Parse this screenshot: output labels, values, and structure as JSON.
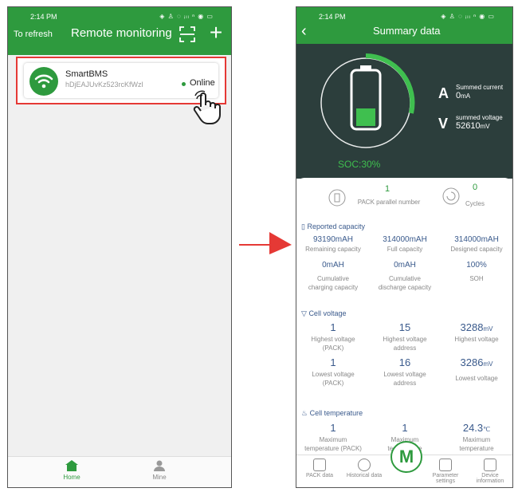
{
  "left_screen": {
    "status": {
      "time": "2:14 PM",
      "icons": "◈ ♙ ◌ ᵢₗₗ ⁿ ◉ ▭"
    },
    "header": {
      "refresh": "To refresh",
      "title": "Remote monitoring"
    },
    "device": {
      "name": "SmartBMS",
      "id": "hDjEAJUvKz523rcKfWzl",
      "status": "Online"
    },
    "tabs": [
      {
        "label": "Home"
      },
      {
        "label": "Mine"
      }
    ]
  },
  "right_screen": {
    "status": {
      "time": "2:14 PM",
      "icons": "◈ ♙ ◌ ᵢₗₗ ⁿ ◉ ▭"
    },
    "header": {
      "title": "Summary data"
    },
    "soc": {
      "text": "SOC:30%",
      "value": 0.3
    },
    "summed_current": {
      "label": "Summed current",
      "value": "0",
      "unit": "mA"
    },
    "summed_voltage": {
      "label": "summed voltage",
      "value": "52610",
      "unit": "mV"
    },
    "pack": {
      "value": "1",
      "label": "PACK parallel number"
    },
    "cycles": {
      "value": "0",
      "label": "Cycles"
    },
    "reported_capacity": {
      "title": "Reported capacity",
      "items": [
        {
          "value": "93190mAH",
          "label": "Remaining capacity"
        },
        {
          "value": "314000mAH",
          "label": "Full capacity"
        },
        {
          "value": "314000mAH",
          "label": "Designed capacity"
        },
        {
          "value": "0mAH",
          "label1": "Cumulative",
          "label2": "charging capacity"
        },
        {
          "value": "0mAH",
          "label1": "Cumulative",
          "label2": "discharge capacity"
        },
        {
          "value": "100%",
          "label": "SOH"
        }
      ]
    },
    "cell_voltage": {
      "title": "Cell voltage",
      "highest_pack": {
        "value": "1",
        "label1": "Highest voltage",
        "label2": "(PACK)"
      },
      "highest_addr": {
        "value": "15",
        "label1": "Highest voltage",
        "label2": "address"
      },
      "highest": {
        "value": "3288",
        "unit": "mV",
        "label": "Highest voltage"
      },
      "lowest_pack": {
        "value": "1",
        "label1": "Lowest voltage",
        "label2": "(PACK)"
      },
      "lowest_addr": {
        "value": "16",
        "label1": "Lowest voltage",
        "label2": "address"
      },
      "lowest": {
        "value": "3286",
        "unit": "mV",
        "label": "Lowest voltage"
      }
    },
    "cell_temperature": {
      "title": "Cell temperature",
      "max_pack": {
        "value": "1",
        "label1": "Maximum",
        "label2": "temperature (PACK)"
      },
      "max_addr": {
        "value": "1",
        "label1": "Maximum",
        "label2": "temperature"
      },
      "max": {
        "value": "24.3",
        "unit": "℃",
        "label1": "Maximum",
        "label2": "temperature"
      }
    },
    "tabs": [
      {
        "label": "PACK data"
      },
      {
        "label": "Historical data"
      },
      {
        "label": "Parameter settings"
      },
      {
        "label": "Device information"
      }
    ]
  },
  "colors": {
    "brand_green": "#2e9a3e",
    "highlight_red": "#e53935",
    "dark_header": "#2c3e3c",
    "value_blue": "#3a5a8c"
  }
}
